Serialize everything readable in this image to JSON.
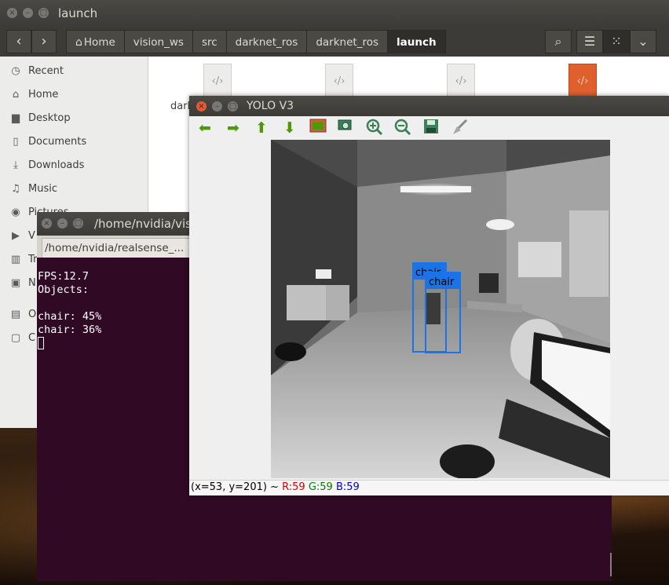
{
  "file_manager": {
    "title": "launch",
    "breadcrumbs": [
      {
        "label": "Home"
      },
      {
        "label": "vision_ws"
      },
      {
        "label": "src"
      },
      {
        "label": "darknet_ros"
      },
      {
        "label": "darknet_ros"
      },
      {
        "label": "launch"
      }
    ],
    "sidebar": [
      {
        "label": "Recent",
        "icon": "clock-icon"
      },
      {
        "label": "Home",
        "icon": "home-icon"
      },
      {
        "label": "Desktop",
        "icon": "folder-icon"
      },
      {
        "label": "Documents",
        "icon": "document-icon"
      },
      {
        "label": "Downloads",
        "icon": "download-icon"
      },
      {
        "label": "Music",
        "icon": "music-icon"
      },
      {
        "label": "Pictures",
        "icon": "camera-icon"
      },
      {
        "label": "V",
        "icon": "video-icon"
      },
      {
        "label": "Tr",
        "icon": "trash-icon"
      },
      {
        "label": "N",
        "icon": "network-icon"
      },
      {
        "label": "O",
        "icon": "drive-icon"
      },
      {
        "label": "C",
        "icon": "usb-icon"
      }
    ],
    "file_label": "dark"
  },
  "terminal": {
    "window_title": "/home/nvidia/vis",
    "tab_title": "/home/nvidia/realsense_...",
    "lines": [
      "FPS:12.7",
      "Objects:",
      "",
      "chair: 45%",
      "chair: 36%"
    ]
  },
  "yolo_window": {
    "title": "YOLO V3",
    "detections": [
      {
        "label": "chair",
        "confidence": 0.45
      },
      {
        "label": "chair",
        "confidence": 0.36
      }
    ],
    "status": {
      "coords": "(x=53, y=201) ~",
      "r": "R:59",
      "g": "G:59",
      "b": "B:59"
    }
  }
}
